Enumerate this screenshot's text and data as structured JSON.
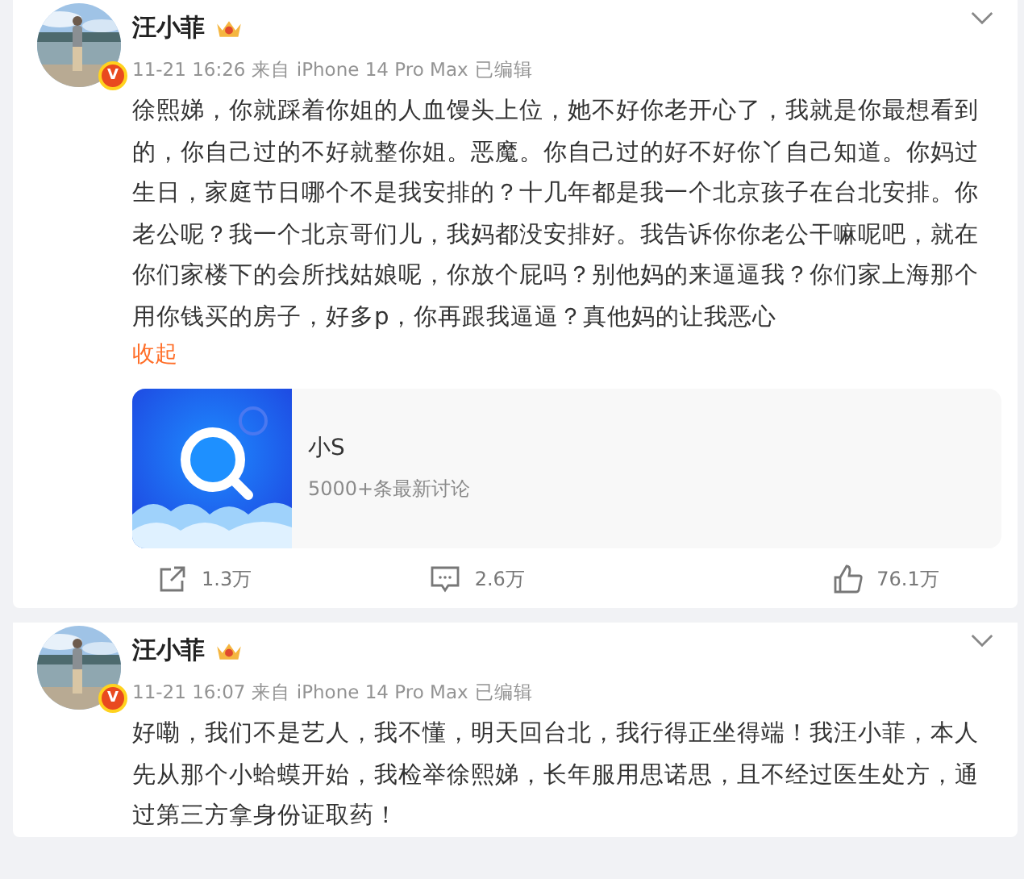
{
  "posts": [
    {
      "author": "汪小菲",
      "verified_badge": "V",
      "time": "11-21 16:26",
      "source": "来自 iPhone 14 Pro Max",
      "edited": "已编辑",
      "text": "徐熙娣，你就踩着你姐的人血馒头上位，她不好你老开心了，我就是你最想看到的，你自己过的不好就整你姐。恶魔。你自己过的好不好你丫自己知道。你妈过生日，家庭节日哪个不是我安排的？十几年都是我一个北京孩子在台北安排。你老公呢？我一个北京哥们儿，我妈都没安排好。我告诉你你老公干嘛呢吧，就在你们家楼下的会所找姑娘呢，你放个屁吗？别他妈的来逼逼我？你们家上海那个用你钱买的房子，好多p，你再跟我逼逼？真他妈的让我恶心",
      "collapse": "收起",
      "topic": {
        "title": "小S",
        "subtitle": "5000+条最新讨论"
      },
      "actions": [
        {
          "kind": "repost",
          "count": "1.3万"
        },
        {
          "kind": "comment",
          "count": "2.6万"
        },
        {
          "kind": "like",
          "count": "76.1万"
        }
      ]
    },
    {
      "author": "汪小菲",
      "verified_badge": "V",
      "time": "11-21 16:07",
      "source": "来自 iPhone 14 Pro Max",
      "edited": "已编辑",
      "text": "好嘞，我们不是艺人，我不懂，明天回台北，我行得正坐得端！我汪小菲，本人先从那个小蛤蟆开始，我检举徐熙娣，长年服用思诺思，且不经过医生处方，通过第三方拿身份证取药！"
    }
  ]
}
